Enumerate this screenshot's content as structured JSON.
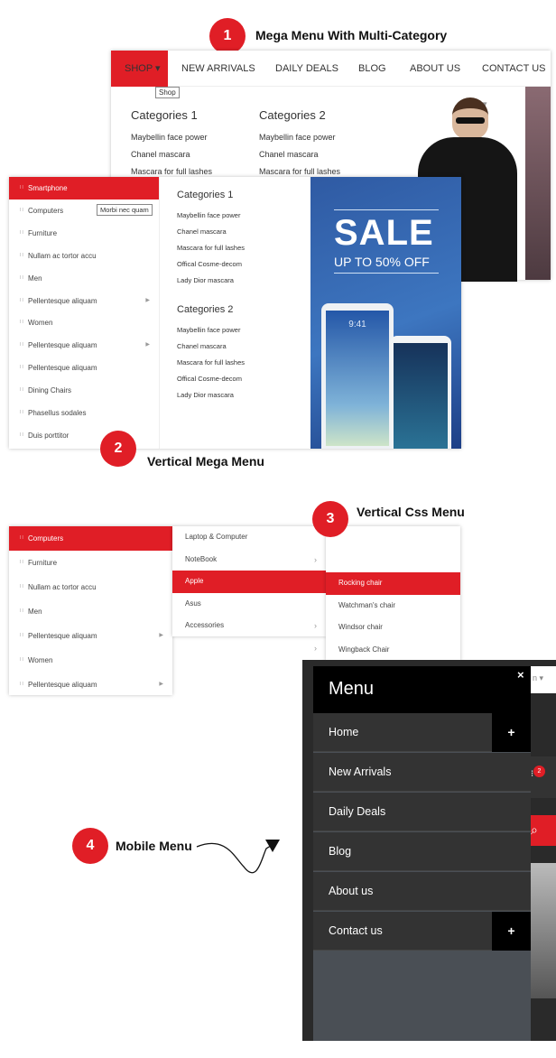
{
  "sections": [
    {
      "number": "1",
      "title": "Mega Menu With Multi-Category"
    },
    {
      "number": "2",
      "title": "Vertical Mega Menu"
    },
    {
      "number": "3",
      "title": "Vertical Css Menu"
    },
    {
      "number": "4",
      "title": "Mobile Menu"
    }
  ],
  "mega": {
    "nav": [
      "SHOP",
      "NEW ARRIVALS",
      "DAILY DEALS",
      "BLOG",
      "ABOUT US",
      "CONTACT US"
    ],
    "tooltip": "Shop",
    "columns": [
      {
        "title": "Categories 1",
        "links": [
          "Maybellin face power",
          "Chanel mascara",
          "Mascara for full lashes"
        ]
      },
      {
        "title": "Categories 2",
        "links": [
          "Maybellin face power",
          "Chanel mascara",
          "Mascara for full lashes"
        ]
      }
    ]
  },
  "vertical": {
    "items": [
      "Smartphone",
      "Computers",
      "Furniture",
      "Nullam ac tortor accu",
      "Men",
      "Pellentesque aliquam",
      "Women",
      "Pellentesque aliquam",
      "Pellentesque aliquam",
      "Dining Chairs",
      "Phasellus sodales",
      "Duis porttitor"
    ],
    "tooltip": "Morbi nec quam",
    "groups": [
      {
        "title": "Categories 1",
        "links": [
          "Maybellin face power",
          "Chanel mascara",
          "Mascara for full lashes",
          "Offical Cosme-decom",
          "Lady Dior mascara"
        ]
      },
      {
        "title": "Categories 2",
        "links": [
          "Maybellin face power",
          "Chanel mascara",
          "Mascara for full lashes",
          "Offical Cosme-decom",
          "Lady Dior mascara"
        ]
      }
    ],
    "banner": {
      "title": "SALE",
      "subtitle": "UP TO 50% OFF",
      "time": "9:41"
    }
  },
  "css": {
    "col1": [
      "Computers",
      "Furniture",
      "Nullam ac tortor accu",
      "Men",
      "Pellentesque aliquam",
      "Women",
      "Pellentesque aliquam"
    ],
    "col2": [
      "Laptop & Computer",
      "NoteBook",
      "Apple",
      "Asus",
      "Accessories"
    ],
    "col3": [
      "Rocking chair",
      "Watchman's chair",
      "Windsor chair",
      "Wingback Chair"
    ]
  },
  "mobile": {
    "title": "Menu",
    "close": "×",
    "items": [
      "Home",
      "New Arrivals",
      "Daily Deals",
      "Blog",
      "About us",
      "Contact us"
    ],
    "cart_count": "2"
  },
  "colors": {
    "accent": "#e01e26",
    "dark": "#333333"
  }
}
